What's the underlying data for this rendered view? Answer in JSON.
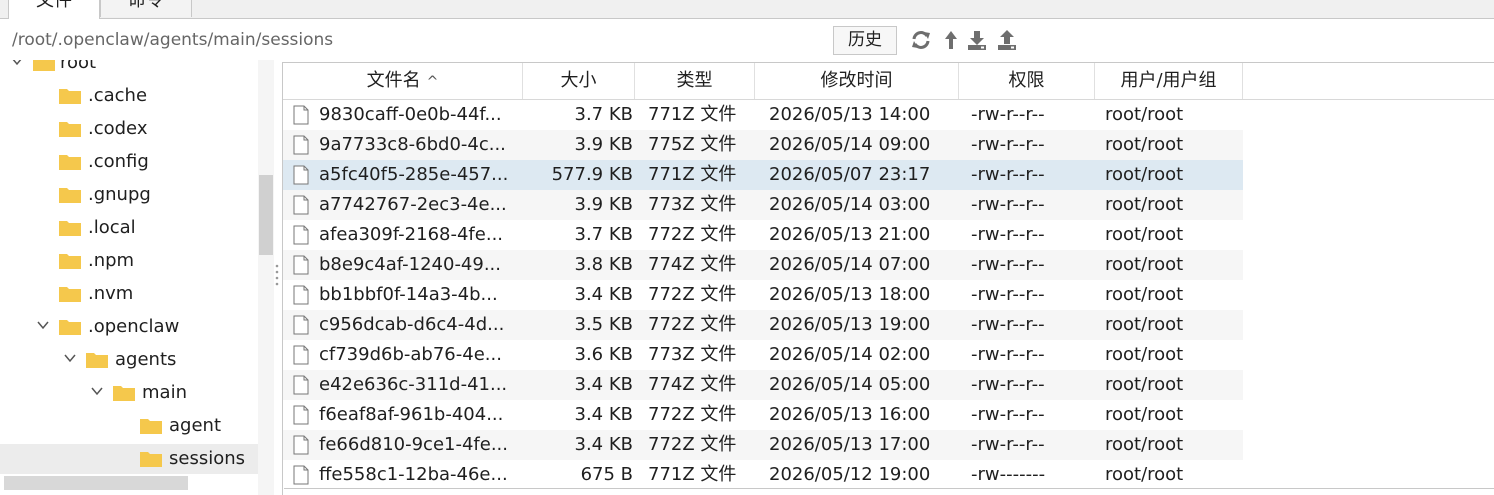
{
  "tabs": [
    {
      "label": "文件"
    },
    {
      "label": "命令"
    }
  ],
  "path": {
    "value": "/root/.openclaw/agents/main/sessions"
  },
  "toolbar": {
    "history_label": "历史",
    "icons": [
      "refresh-icon",
      "up-arrow-icon",
      "download-icon",
      "upload-icon"
    ]
  },
  "tree": [
    {
      "label": "root"
    },
    {
      "label": ".cache"
    },
    {
      "label": ".codex"
    },
    {
      "label": ".config"
    },
    {
      "label": ".gnupg"
    },
    {
      "label": ".local"
    },
    {
      "label": ".npm"
    },
    {
      "label": ".nvm"
    },
    {
      "label": ".openclaw"
    },
    {
      "label": "agents"
    },
    {
      "label": "main"
    },
    {
      "label": "agent"
    },
    {
      "label": "sessions"
    }
  ],
  "table": {
    "columns": [
      "文件名",
      "大小",
      "类型",
      "修改时间",
      "权限",
      "用户/用户组"
    ],
    "sort_indicator": "^",
    "rows": [
      {
        "name": "9830caff-0e0b-44f...",
        "size": "3.7 KB",
        "type": "771Z 文件",
        "mtime": "2026/05/13 14:00",
        "perm": "-rw-r--r--",
        "owner": "root/root"
      },
      {
        "name": "9a7733c8-6bd0-4c...",
        "size": "3.9 KB",
        "type": "775Z 文件",
        "mtime": "2026/05/14 09:00",
        "perm": "-rw-r--r--",
        "owner": "root/root"
      },
      {
        "name": "a5fc40f5-285e-457...",
        "size": "577.9 KB",
        "type": "771Z 文件",
        "mtime": "2026/05/07 23:17",
        "perm": "-rw-r--r--",
        "owner": "root/root"
      },
      {
        "name": "a7742767-2ec3-4e...",
        "size": "3.9 KB",
        "type": "773Z 文件",
        "mtime": "2026/05/14 03:00",
        "perm": "-rw-r--r--",
        "owner": "root/root"
      },
      {
        "name": "afea309f-2168-4fe...",
        "size": "3.7 KB",
        "type": "772Z 文件",
        "mtime": "2026/05/13 21:00",
        "perm": "-rw-r--r--",
        "owner": "root/root"
      },
      {
        "name": "b8e9c4af-1240-49...",
        "size": "3.8 KB",
        "type": "774Z 文件",
        "mtime": "2026/05/14 07:00",
        "perm": "-rw-r--r--",
        "owner": "root/root"
      },
      {
        "name": "bb1bbf0f-14a3-4b...",
        "size": "3.4 KB",
        "type": "772Z 文件",
        "mtime": "2026/05/13 18:00",
        "perm": "-rw-r--r--",
        "owner": "root/root"
      },
      {
        "name": "c956dcab-d6c4-4d...",
        "size": "3.5 KB",
        "type": "772Z 文件",
        "mtime": "2026/05/13 19:00",
        "perm": "-rw-r--r--",
        "owner": "root/root"
      },
      {
        "name": "cf739d6b-ab76-4e...",
        "size": "3.6 KB",
        "type": "773Z 文件",
        "mtime": "2026/05/14 02:00",
        "perm": "-rw-r--r--",
        "owner": "root/root"
      },
      {
        "name": "e42e636c-311d-41...",
        "size": "3.4 KB",
        "type": "774Z 文件",
        "mtime": "2026/05/14 05:00",
        "perm": "-rw-r--r--",
        "owner": "root/root"
      },
      {
        "name": "f6eaf8af-961b-404...",
        "size": "3.4 KB",
        "type": "772Z 文件",
        "mtime": "2026/05/13 16:00",
        "perm": "-rw-r--r--",
        "owner": "root/root"
      },
      {
        "name": "fe66d810-9ce1-4fe...",
        "size": "3.4 KB",
        "type": "772Z 文件",
        "mtime": "2026/05/13 17:00",
        "perm": "-rw-r--r--",
        "owner": "root/root"
      },
      {
        "name": "ffe558c1-12ba-46e...",
        "size": "675 B",
        "type": "771Z 文件",
        "mtime": "2026/05/12 19:00",
        "perm": "-rw-------",
        "owner": "root/root"
      }
    ]
  },
  "colors": {
    "folder": "#f5c84c",
    "selected_row": "#dde9f2",
    "icon_gray": "#6e6e6e"
  }
}
